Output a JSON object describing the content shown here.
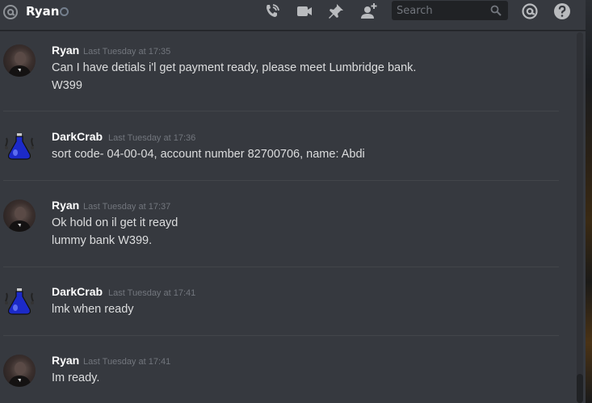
{
  "header": {
    "channel_name": "Ryan",
    "search_placeholder": "Search",
    "icons": [
      "at-icon",
      "phone-call-icon",
      "video-call-icon",
      "pin-icon",
      "add-friend-icon",
      "search-icon",
      "mentions-icon",
      "help-icon"
    ]
  },
  "messages": [
    {
      "author": "Ryan",
      "timestamp": "Last Tuesday at 17:35",
      "lines": [
        "Can I have detials i'l get payment ready, please meet Lumbridge bank.",
        "W399"
      ]
    },
    {
      "author": "DarkCrab",
      "timestamp": "Last Tuesday at 17:36",
      "lines": [
        "sort code- 04-00-04, account number 82700706, name: Abdi"
      ]
    },
    {
      "author": "Ryan",
      "timestamp": "Last Tuesday at 17:37",
      "lines": [
        "Ok hold on il get it reayd",
        "lummy bank W399."
      ]
    },
    {
      "author": "DarkCrab",
      "timestamp": "Last Tuesday at 17:41",
      "lines": [
        "lmk when ready"
      ]
    },
    {
      "author": "Ryan",
      "timestamp": "Last Tuesday at 17:41",
      "lines": [
        "Im ready."
      ]
    }
  ],
  "colors": {
    "background": "#36393f",
    "text": "#dcddde",
    "author": "#ffffff",
    "timestamp": "#72767d",
    "icon": "#b9bbbe"
  }
}
